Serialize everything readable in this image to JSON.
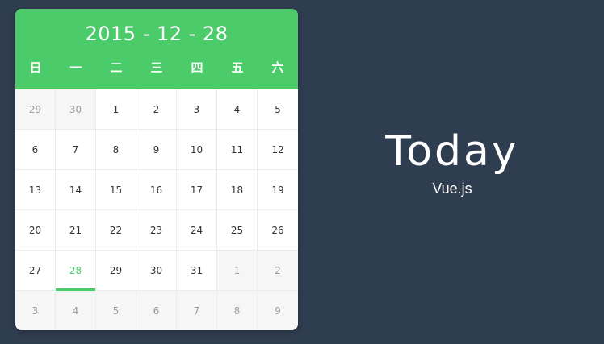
{
  "calendar": {
    "date_label": "2015 - 12 - 28",
    "accent_color": "#4ccb6a",
    "weekdays": [
      "日",
      "一",
      "二",
      "三",
      "四",
      "五",
      "六"
    ],
    "weeks": [
      [
        {
          "d": "29",
          "other": true
        },
        {
          "d": "30",
          "other": true
        },
        {
          "d": "1"
        },
        {
          "d": "2"
        },
        {
          "d": "3"
        },
        {
          "d": "4"
        },
        {
          "d": "5"
        }
      ],
      [
        {
          "d": "6"
        },
        {
          "d": "7"
        },
        {
          "d": "8"
        },
        {
          "d": "9"
        },
        {
          "d": "10"
        },
        {
          "d": "11"
        },
        {
          "d": "12"
        }
      ],
      [
        {
          "d": "13"
        },
        {
          "d": "14"
        },
        {
          "d": "15"
        },
        {
          "d": "16"
        },
        {
          "d": "17"
        },
        {
          "d": "18"
        },
        {
          "d": "19"
        }
      ],
      [
        {
          "d": "20"
        },
        {
          "d": "21"
        },
        {
          "d": "22"
        },
        {
          "d": "23"
        },
        {
          "d": "24"
        },
        {
          "d": "25"
        },
        {
          "d": "26"
        }
      ],
      [
        {
          "d": "27"
        },
        {
          "d": "28",
          "today": true
        },
        {
          "d": "29"
        },
        {
          "d": "30"
        },
        {
          "d": "31"
        },
        {
          "d": "1",
          "other": true
        },
        {
          "d": "2",
          "other": true
        }
      ],
      [
        {
          "d": "3",
          "other": true
        },
        {
          "d": "4",
          "other": true
        },
        {
          "d": "5",
          "other": true
        },
        {
          "d": "6",
          "other": true
        },
        {
          "d": "7",
          "other": true
        },
        {
          "d": "8",
          "other": true
        },
        {
          "d": "9",
          "other": true
        }
      ]
    ]
  },
  "brand": {
    "title": "Today",
    "subtitle": "Vue.js"
  },
  "background_color": "#2f3d50"
}
